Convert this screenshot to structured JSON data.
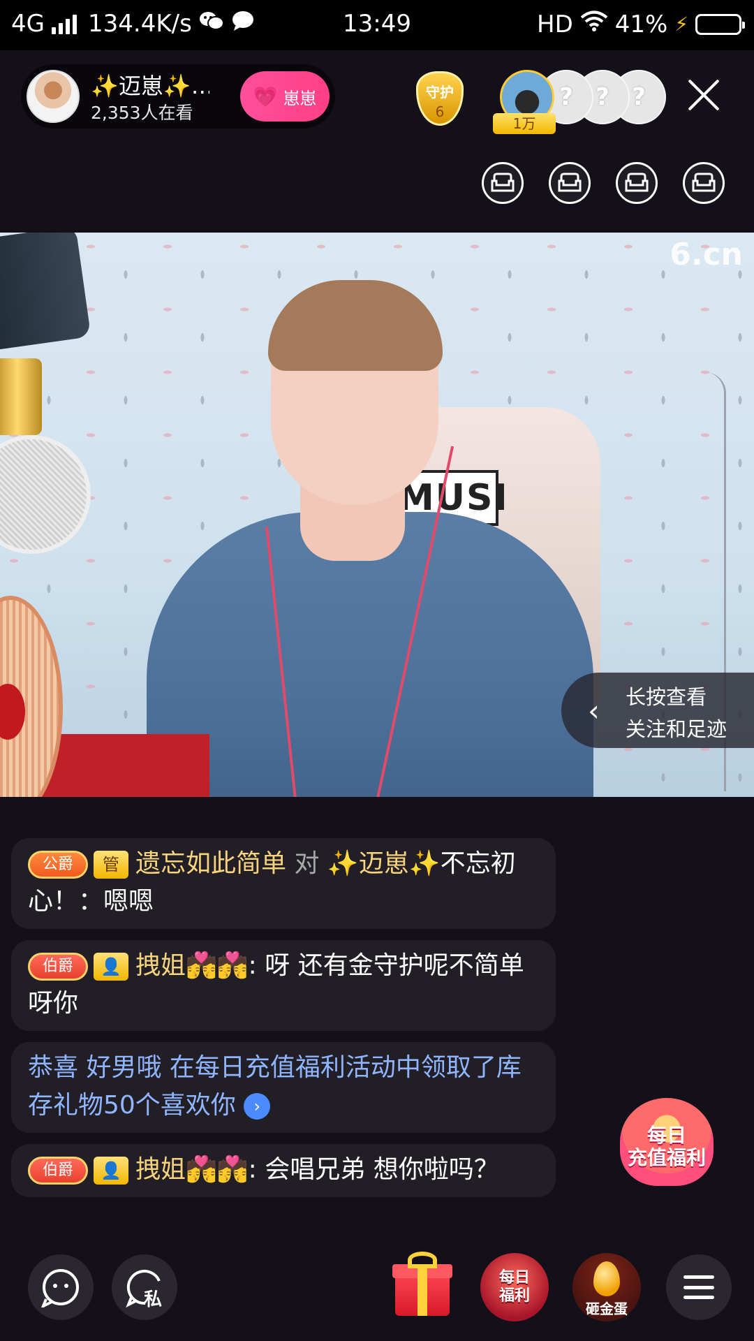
{
  "status_bar": {
    "network": "4G",
    "speed": "134.4K/s",
    "time": "13:49",
    "hd": "HD",
    "battery_percent": "41%",
    "battery_level": 0.41
  },
  "host": {
    "name": "✨迈崽✨…",
    "viewers": "2,353人在看",
    "follow_label": "崽崽"
  },
  "guard": {
    "label": "守护",
    "count": "6"
  },
  "top_fans": {
    "first_tag": "1万",
    "unknown_mark": "?"
  },
  "video": {
    "watermark": "6.cn",
    "chair_text": "MUSI",
    "footprint_line1": "长按查看",
    "footprint_line2": "关注和足迹"
  },
  "chat": {
    "messages": [
      {
        "title": "公爵",
        "role": "管",
        "user": "遗忘如此简单",
        "connector": " 对 ",
        "target": "✨迈崽✨",
        "text": "不忘初心！：嗯嗯"
      },
      {
        "title": "伯爵",
        "user": "拽姐💏💏",
        "text": ": 呀   还有金守护呢不简单呀你"
      },
      {
        "system": "恭喜 好男哦  在每日充值福利活动中领取了库存礼物50个喜欢你",
        "info": "›"
      },
      {
        "title": "伯爵",
        "user": "拽姐💏💏",
        "text": ": 会唱兄弟  想你啦吗？"
      }
    ]
  },
  "recharge_widget": {
    "line1": "每日",
    "line2": "充值福利"
  },
  "bottom_bar": {
    "private_label": "私",
    "daily_line1": "每日",
    "daily_line2": "福利",
    "egg_label": "砸金蛋"
  },
  "colors": {
    "background": "#141019",
    "follow_pink": "#ff4f9a",
    "username_gold": "#f7d37d",
    "system_blue": "#8fb5ff"
  }
}
